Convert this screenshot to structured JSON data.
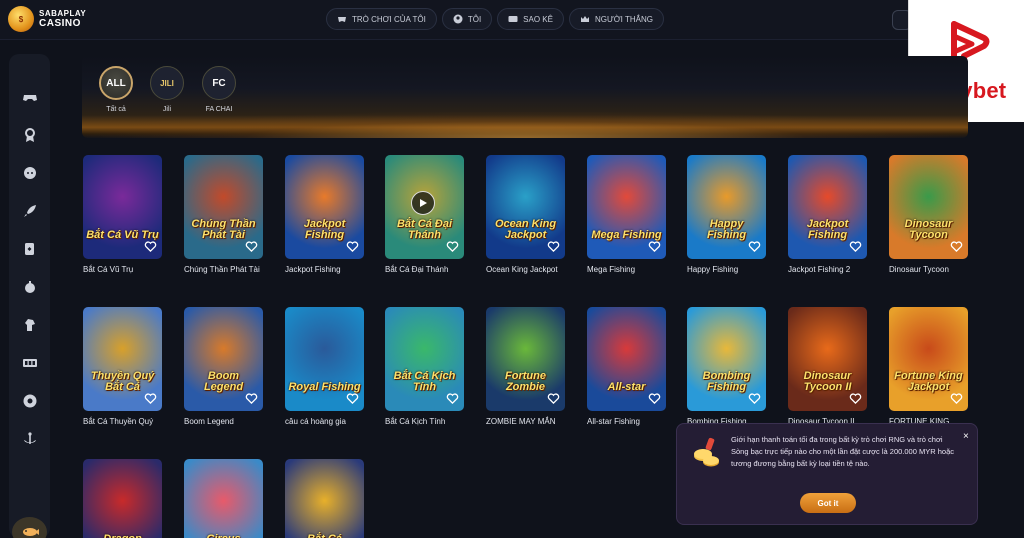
{
  "header": {
    "logo_line1": "SABAPLAY",
    "logo_line2": "CASINO",
    "nav": [
      {
        "label": "Trò chơi của tôi",
        "icon": "gamepad-heart-icon"
      },
      {
        "label": "Tôi",
        "icon": "user-icon"
      },
      {
        "label": "Sao kê",
        "icon": "ticket-icon"
      },
      {
        "label": "Người thắng",
        "icon": "crown-icon"
      }
    ]
  },
  "watermark": {
    "text": "Playbet",
    "color": "#d7181f"
  },
  "sidebar": {
    "icons": [
      "gamepad-icon",
      "award-icon",
      "chat-icon",
      "rocket-icon",
      "cards-icon",
      "bomb-icon",
      "horse-icon",
      "slot-machine-icon",
      "billiard-ball-icon",
      "anchor-icon",
      "fishing-icon"
    ]
  },
  "filters": [
    {
      "code": "ALL",
      "label": "Tất cả",
      "active": true
    },
    {
      "code": "JILI",
      "label": "Jili",
      "active": false
    },
    {
      "code": "FC",
      "label": "FA CHAI",
      "active": false
    }
  ],
  "games": [
    {
      "name": "Bắt Cá Vũ Trụ",
      "art": "Bắt Cá Vũ Trụ"
    },
    {
      "name": "Chúng Thần Phát Tài",
      "art": "Chúng Thần Phát Tài"
    },
    {
      "name": "Jackpot Fishing",
      "art": "Jackpot Fishing"
    },
    {
      "name": "Bắt Cá Đại Thánh",
      "art": "Bắt Cá Đại Thánh"
    },
    {
      "name": "Ocean King Jackpot",
      "art": "Ocean King Jackpot"
    },
    {
      "name": "Mega Fishing",
      "art": "Mega Fishing"
    },
    {
      "name": "Happy Fishing",
      "art": "Happy Fishing"
    },
    {
      "name": "Jackpot Fishing 2",
      "art": "Jackpot Fishing"
    },
    {
      "name": "Dinosaur Tycoon",
      "art": "Dinosaur Tycoon"
    },
    {
      "name": "Bắt Cá Thuyền Quý",
      "art": "Thuyền Quý Bắt Cá"
    },
    {
      "name": "Boom Legend",
      "art": "Boom Legend"
    },
    {
      "name": "câu cá hoàng gia",
      "art": "Royal Fishing"
    },
    {
      "name": "Bắt Cá Kịch Tính",
      "art": "Bắt Cá Kịch Tính"
    },
    {
      "name": "ZOMBIE MAY MẮN",
      "art": "Fortune Zombie"
    },
    {
      "name": "All-star Fishing",
      "art": "All-star"
    },
    {
      "name": "Bombing Fishing",
      "art": "Bombing Fishing"
    },
    {
      "name": "Dinosaur Tycoon II",
      "art": "Dinosaur Tycoon II"
    },
    {
      "name": "FORTUNE KING",
      "art": "Fortune King Jackpot"
    },
    {
      "name": "",
      "art": "Dragon"
    },
    {
      "name": "",
      "art": "Circus"
    },
    {
      "name": "",
      "art": "Bắt Cá"
    }
  ],
  "notice": {
    "text": "Giới hạn thanh toán tối đa trong bất kỳ trò chơi RNG và trò chơi Sòng bạc trực tiếp nào cho một lần đặt cược là 200.000 MYR hoặc tương đương bằng bất kỳ loại tiền tệ nào.",
    "close": "×",
    "button": "Got it"
  }
}
